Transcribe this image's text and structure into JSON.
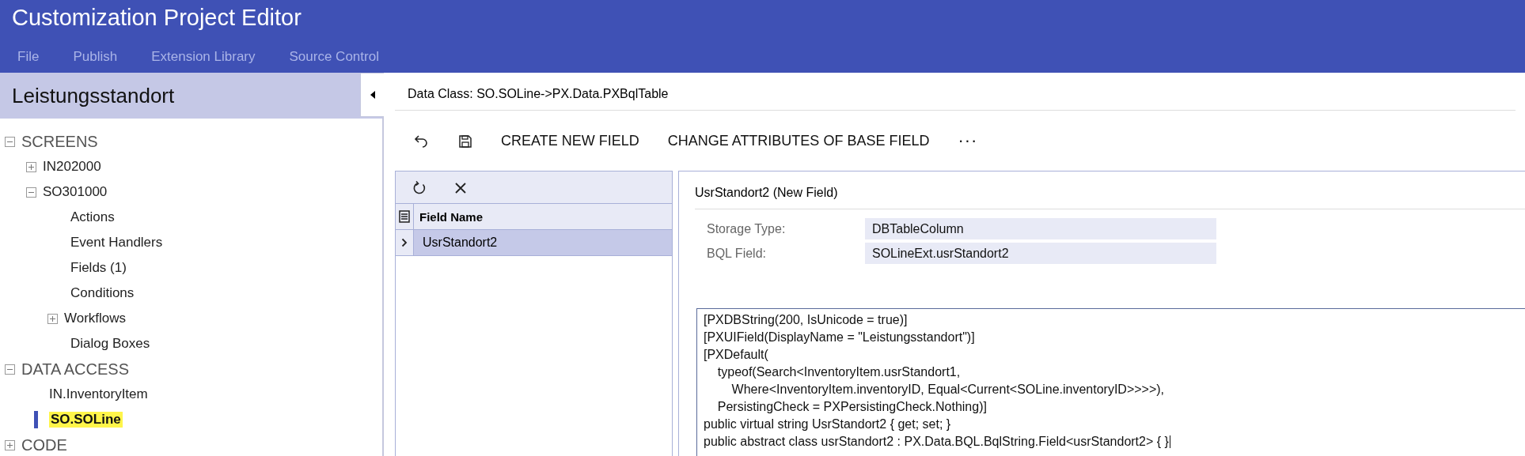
{
  "window": {
    "title": "Customization Project Editor"
  },
  "menu": [
    {
      "label": "File"
    },
    {
      "label": "Publish"
    },
    {
      "label": "Extension Library"
    },
    {
      "label": "Source Control"
    }
  ],
  "sidebar": {
    "title": "Leistungsstandort",
    "tree": [
      {
        "label": "SCREENS",
        "kind": "section",
        "expanded": true,
        "selected": false,
        "children": [
          {
            "label": "IN202000",
            "kind": "node",
            "expanded": false,
            "selected": false
          },
          {
            "label": "SO301000",
            "kind": "node",
            "expanded": true,
            "selected": false,
            "children": [
              {
                "label": "Actions",
                "kind": "leaf",
                "selected": false
              },
              {
                "label": "Event Handlers",
                "kind": "leaf",
                "selected": false
              },
              {
                "label": "Fields (1)",
                "kind": "leaf",
                "selected": false
              },
              {
                "label": "Conditions",
                "kind": "leaf",
                "selected": false
              },
              {
                "label": "Workflows",
                "kind": "node",
                "expanded": false,
                "selected": false
              },
              {
                "label": "Dialog Boxes",
                "kind": "leaf",
                "selected": false
              }
            ]
          }
        ]
      },
      {
        "label": "DATA ACCESS",
        "kind": "section",
        "expanded": true,
        "selected": false,
        "children": [
          {
            "label": "IN.InventoryItem",
            "kind": "leaf",
            "selected": false
          },
          {
            "label": "SO.SOLine",
            "kind": "leaf",
            "selected": true
          }
        ]
      },
      {
        "label": "CODE",
        "kind": "section",
        "expanded": false,
        "selected": false
      }
    ]
  },
  "data_class": "Data Class: SO.SOLine->PX.Data.PXBqlTable",
  "toolbar": {
    "buttons": [
      {
        "label": "CREATE NEW FIELD"
      },
      {
        "label": "CHANGE ATTRIBUTES OF BASE FIELD"
      }
    ],
    "more": "···"
  },
  "grid": {
    "columns": [
      {
        "label": "Field Name"
      }
    ],
    "rows": [
      {
        "cells": [
          "UsrStandort2"
        ],
        "selected": true
      }
    ]
  },
  "detail": {
    "title": "UsrStandort2 (New Field)",
    "fields": [
      {
        "label": "Storage Type:",
        "value": "DBTableColumn"
      },
      {
        "label": "BQL Field:",
        "value": "SOLineExt.usrStandort2"
      }
    ],
    "code": [
      "[PXDBString(200, IsUnicode = true)]",
      "[PXUIField(DisplayName = \"Leistungsstandort\")]",
      "[PXDefault(",
      "    typeof(Search<InventoryItem.usrStandort1,",
      "        Where<InventoryItem.inventoryID, Equal<Current<SOLine.inventoryID>>>>),",
      "    PersistingCheck = PXPersistingCheck.Nothing)]",
      "public virtual string UsrStandort2 { get; set; }",
      "public abstract class usrStandort2 : PX.Data.BQL.BqlString.Field<usrStandort2> { }"
    ]
  }
}
